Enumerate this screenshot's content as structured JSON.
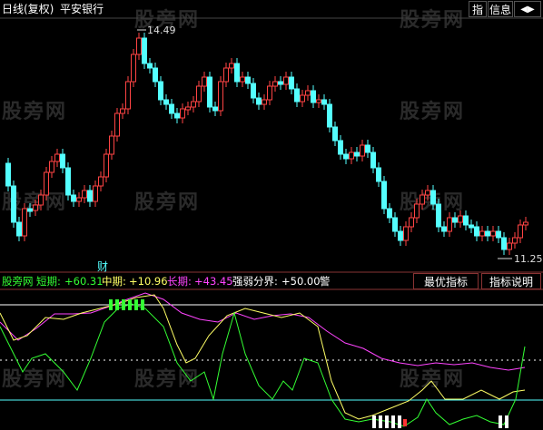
{
  "header": {
    "period": "日线(复权)",
    "stock_name": "平安银行",
    "btn_index": "指",
    "btn_info": "信息",
    "btn_arrow": "◀▶"
  },
  "watermark": "股旁网",
  "price_panel": {
    "high_label": "14.49",
    "low_label": "11.25",
    "marker": "财",
    "up_color": "#ff4444",
    "down_color": "#54ffff",
    "marker_color": "#54ffff"
  },
  "indicator_panel": {
    "name": "股旁网",
    "short_label": "短期:",
    "short_value": "+60.31",
    "mid_label": "中期:",
    "mid_value": "+10.96",
    "long_label": "长期:",
    "long_value": "+43.45",
    "threshold_label": "强弱分界:",
    "threshold_value": "+50.00",
    "alert_label": "警",
    "btn_best": "最优指标",
    "btn_explain": "指标说明",
    "short_color": "#33ff33",
    "mid_color": "#ffff66",
    "long_color": "#ff44ff",
    "threshold_color": "#ffffff"
  }
}
